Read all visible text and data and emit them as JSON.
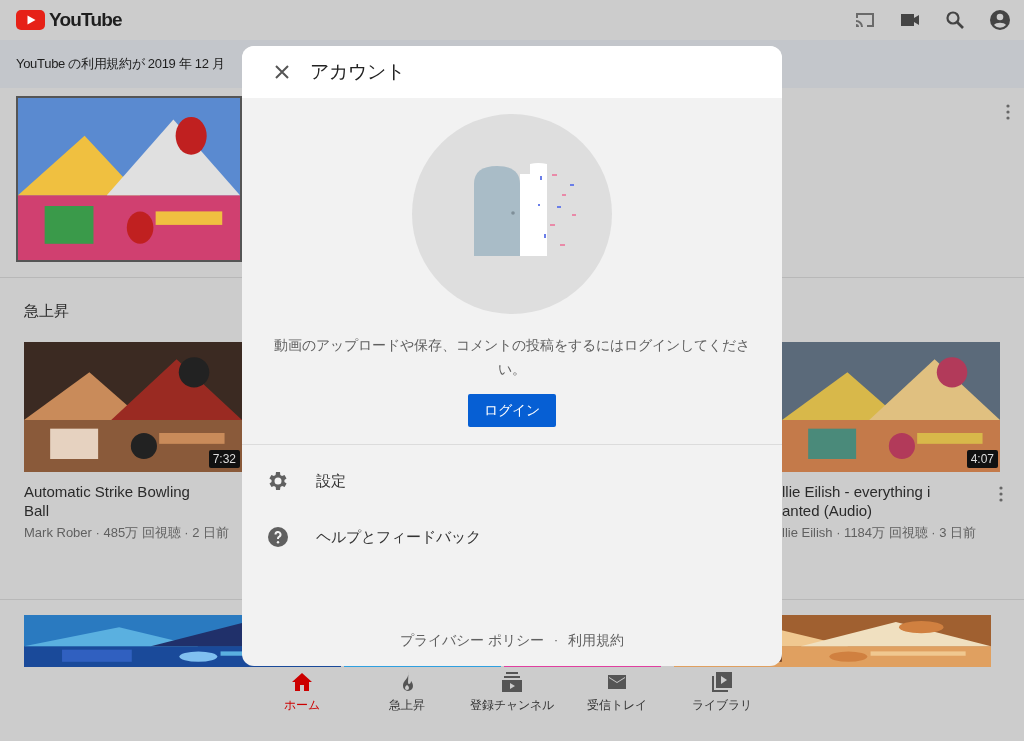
{
  "header": {
    "logo": "YouTube"
  },
  "banner": {
    "text": "YouTube の利用規約が 2019 年 12 月"
  },
  "section_title": "急上昇",
  "videos": [
    {
      "title_lines": [
        "Automatic Strike Bowling",
        "Ball"
      ],
      "meta": "Mark Rober · 485万 回視聴 · 2 日前",
      "duration": "7:32"
    },
    {
      "title_lines": [
        "llie Eilish - everything i",
        "anted (Audio)"
      ],
      "meta": "llie Eilish · 1184万 回視聴 · 3 日前",
      "duration": "4:07"
    }
  ],
  "modal": {
    "title": "アカウント",
    "message": "動画のアップロードや保存、コメントの投稿をするにはログインしてください。",
    "login_button": "ログイン",
    "menu": [
      {
        "kind": "settings",
        "label": "設定"
      },
      {
        "kind": "help",
        "label": "ヘルプとフィードバック"
      }
    ],
    "footer_links": [
      "プライバシー ポリシー",
      "利用規約"
    ],
    "footer_separator": "·"
  },
  "nav": [
    {
      "kind": "home",
      "label": "ホーム",
      "selected": true
    },
    {
      "kind": "trending",
      "label": "急上昇",
      "selected": false
    },
    {
      "kind": "subscriptions",
      "label": "登録チャンネル",
      "selected": false
    },
    {
      "kind": "inbox",
      "label": "受信トレイ",
      "selected": false
    },
    {
      "kind": "library",
      "label": "ライブラリ",
      "selected": false
    }
  ]
}
